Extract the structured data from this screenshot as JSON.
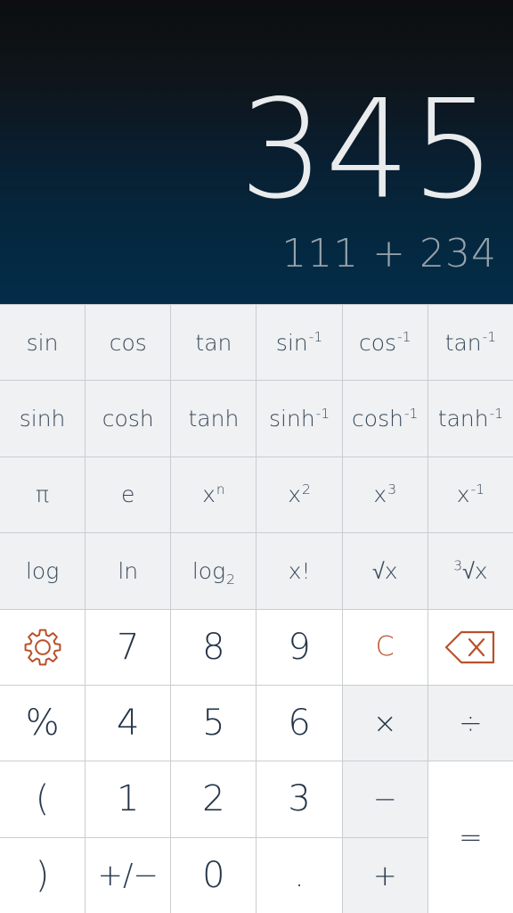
{
  "app": {
    "name": "scientific-calculator"
  },
  "display": {
    "result": "345",
    "expression": "111 + 234",
    "result_color": "#e9ebed",
    "expression_color": "#97a3ac",
    "background_top": "#0c0e10",
    "background_bottom": "#032d49"
  },
  "theme": {
    "accent": "#b8512b",
    "key_text": "#243447",
    "function_key_bg": "#eff1f2",
    "digit_key_bg": "#ffffff",
    "grid_line": "#c9cdd0"
  },
  "keypad": {
    "rows": [
      {
        "name": "trig-row",
        "keys": [
          {
            "name": "sin",
            "label": "sin",
            "style": "fn"
          },
          {
            "name": "cos",
            "label": "cos",
            "style": "fn"
          },
          {
            "name": "tan",
            "label": "tan",
            "style": "fn"
          },
          {
            "name": "asin",
            "base": "sin",
            "sup": "-1",
            "style": "fn"
          },
          {
            "name": "acos",
            "base": "cos",
            "sup": "-1",
            "style": "fn"
          },
          {
            "name": "atan",
            "base": "tan",
            "sup": "-1",
            "style": "fn"
          }
        ]
      },
      {
        "name": "hyperbolic-row",
        "keys": [
          {
            "name": "sinh",
            "label": "sinh",
            "style": "fn"
          },
          {
            "name": "cosh",
            "label": "cosh",
            "style": "fn"
          },
          {
            "name": "tanh",
            "label": "tanh",
            "style": "fn"
          },
          {
            "name": "asinh",
            "base": "sinh",
            "sup": "-1",
            "style": "fn"
          },
          {
            "name": "acosh",
            "base": "cosh",
            "sup": "-1",
            "style": "fn"
          },
          {
            "name": "atanh",
            "base": "tanh",
            "sup": "-1",
            "style": "fn"
          }
        ]
      },
      {
        "name": "constants-powers-row",
        "keys": [
          {
            "name": "pi",
            "label": "π",
            "style": "fn"
          },
          {
            "name": "euler-e",
            "label": "e",
            "style": "fn"
          },
          {
            "name": "power-n",
            "base": "x",
            "sup": "n",
            "style": "fn"
          },
          {
            "name": "square",
            "base": "x",
            "sup": "2",
            "style": "fn"
          },
          {
            "name": "cube",
            "base": "x",
            "sup": "3",
            "style": "fn"
          },
          {
            "name": "reciprocal",
            "base": "x",
            "sup": "-1",
            "style": "fn"
          }
        ]
      },
      {
        "name": "logarithm-roots-row",
        "keys": [
          {
            "name": "log10",
            "label": "log",
            "style": "fn"
          },
          {
            "name": "natural-log",
            "label": "ln",
            "style": "fn"
          },
          {
            "name": "log2",
            "base": "log",
            "sub": "2",
            "style": "fn"
          },
          {
            "name": "factorial",
            "label": "x!",
            "style": "fn"
          },
          {
            "name": "square-root",
            "label": "√x",
            "style": "fn"
          },
          {
            "name": "cube-root",
            "presup": "3",
            "base": "√x",
            "style": "fn"
          }
        ]
      },
      {
        "name": "seven-eight-nine-row",
        "keys": [
          {
            "name": "settings",
            "icon": "gear-icon",
            "style": "accent"
          },
          {
            "name": "digit-7",
            "label": "7",
            "style": "digit"
          },
          {
            "name": "digit-8",
            "label": "8",
            "style": "digit"
          },
          {
            "name": "digit-9",
            "label": "9",
            "style": "digit"
          },
          {
            "name": "clear",
            "label": "C",
            "style": "accent"
          },
          {
            "name": "backspace",
            "icon": "backspace-icon",
            "style": "accent"
          }
        ]
      },
      {
        "name": "four-five-six-row",
        "keys": [
          {
            "name": "percent",
            "label": "%",
            "style": "digit"
          },
          {
            "name": "digit-4",
            "label": "4",
            "style": "digit"
          },
          {
            "name": "digit-5",
            "label": "5",
            "style": "digit"
          },
          {
            "name": "digit-6",
            "label": "6",
            "style": "digit"
          },
          {
            "name": "multiply",
            "label": "×",
            "style": "op"
          },
          {
            "name": "divide",
            "label": "÷",
            "style": "op"
          }
        ]
      },
      {
        "name": "one-two-three-row",
        "keys": [
          {
            "name": "open-paren",
            "label": "(",
            "style": "paren"
          },
          {
            "name": "digit-1",
            "label": "1",
            "style": "digit"
          },
          {
            "name": "digit-2",
            "label": "2",
            "style": "digit"
          },
          {
            "name": "digit-3",
            "label": "3",
            "style": "digit"
          },
          {
            "name": "subtract",
            "label": "−",
            "style": "op"
          },
          {
            "name": "equals",
            "label": "=",
            "style": "equals"
          }
        ]
      },
      {
        "name": "zero-row",
        "keys": [
          {
            "name": "close-paren",
            "label": ")",
            "style": "paren"
          },
          {
            "name": "sign-toggle",
            "label": "+/−",
            "style": "pm"
          },
          {
            "name": "digit-0",
            "label": "0",
            "style": "digit"
          },
          {
            "name": "decimal-point",
            "label": ".",
            "style": "dot"
          },
          {
            "name": "add",
            "label": "+",
            "style": "op"
          }
        ]
      }
    ]
  }
}
